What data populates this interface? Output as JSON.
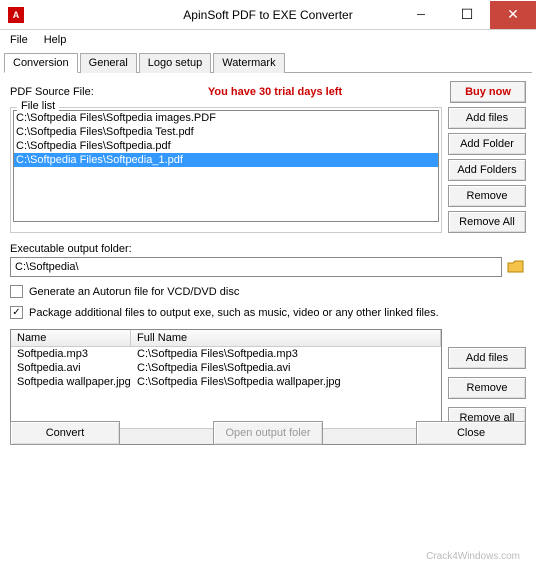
{
  "window": {
    "title": "ApinSoft PDF to EXE Converter"
  },
  "menu": {
    "file": "File",
    "help": "Help"
  },
  "tabs": {
    "conversion": "Conversion",
    "general": "General",
    "logo": "Logo setup",
    "watermark": "Watermark"
  },
  "source": {
    "label": "PDF Source File:",
    "trial": "You have 30 trial days left",
    "buynow": "Buy now",
    "legend": "File list",
    "files": [
      "C:\\Softpedia Files\\Softpedia images.PDF",
      "C:\\Softpedia Files\\Softpedia Test.pdf",
      "C:\\Softpedia Files\\Softpedia.pdf",
      "C:\\Softpedia Files\\Softpedia_1.pdf"
    ],
    "selected_index": 3,
    "buttons": {
      "addfiles": "Add files",
      "addfolder": "Add Folder",
      "addfolders": "Add Folders",
      "remove": "Remove",
      "removeall": "Remove All"
    }
  },
  "output": {
    "label": "Executable output folder:",
    "value": "C:\\Softpedia\\"
  },
  "checks": {
    "autorun": {
      "checked": false,
      "label": "Generate an Autorun file for VCD/DVD disc"
    },
    "package": {
      "checked": true,
      "label": "Package additional files to output exe, such as music, video or any other linked files."
    }
  },
  "addl": {
    "col_name": "Name",
    "col_full": "Full Name",
    "rows": [
      {
        "name": "Softpedia.mp3",
        "full": "C:\\Softpedia Files\\Softpedia.mp3"
      },
      {
        "name": "Softpedia.avi",
        "full": "C:\\Softpedia Files\\Softpedia.avi"
      },
      {
        "name": "Softpedia wallpaper.jpg",
        "full": "C:\\Softpedia Files\\Softpedia wallpaper.jpg"
      }
    ],
    "buttons": {
      "addfiles": "Add files",
      "remove": "Remove",
      "removeall": "Remove all"
    }
  },
  "bottom": {
    "convert": "Convert",
    "openfolder": "Open output foler",
    "close": "Close"
  },
  "watermark_text": "Crack4Windows.com"
}
